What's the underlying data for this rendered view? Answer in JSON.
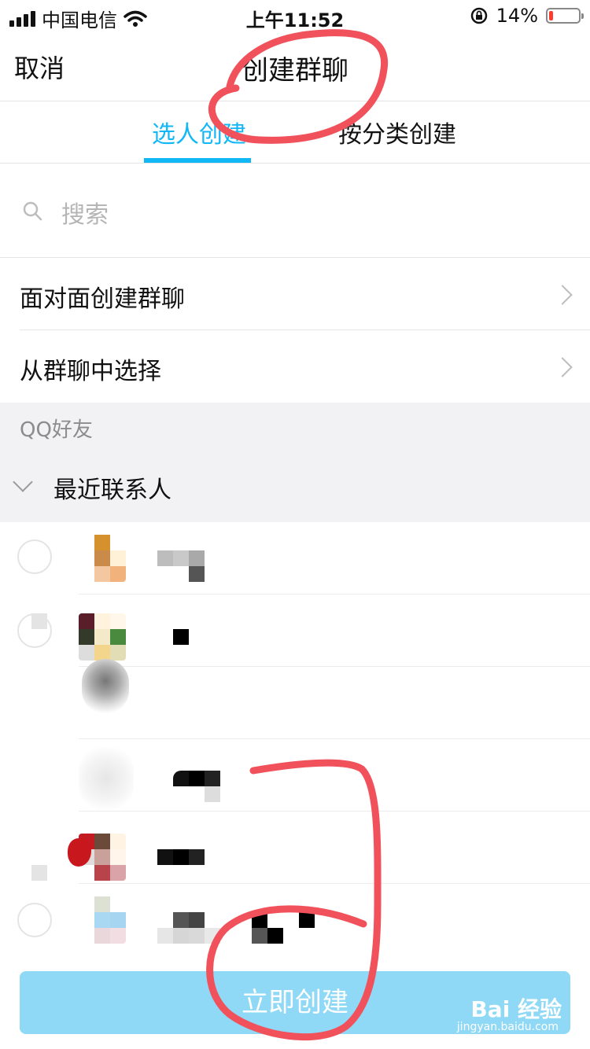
{
  "status_bar": {
    "carrier": "中国电信",
    "time": "上午11:52",
    "battery": "14%",
    "battery_level": 0.14,
    "icons": [
      "signal-icon",
      "wifi-icon",
      "rotation-lock-icon",
      "battery-icon"
    ]
  },
  "nav": {
    "cancel_label": "取消",
    "title": "创建群聊"
  },
  "tabs": [
    {
      "label": "选人创建",
      "active": true
    },
    {
      "label": "按分类创建",
      "active": false
    }
  ],
  "search": {
    "placeholder": "搜索"
  },
  "options": [
    {
      "label": "面对面创建群聊"
    },
    {
      "label": "从群聊中选择"
    }
  ],
  "friends": {
    "section_title": "QQ好友",
    "group_title": "最近联系人"
  },
  "create_button": {
    "label": "立即创建"
  },
  "watermark": {
    "brand": "Bai 经验",
    "url": "jingyan.baidu.com"
  },
  "colors": {
    "accent": "#12b7f5",
    "create_button_bg": "#8fd8f6",
    "annotation_red": "#f0515a"
  }
}
